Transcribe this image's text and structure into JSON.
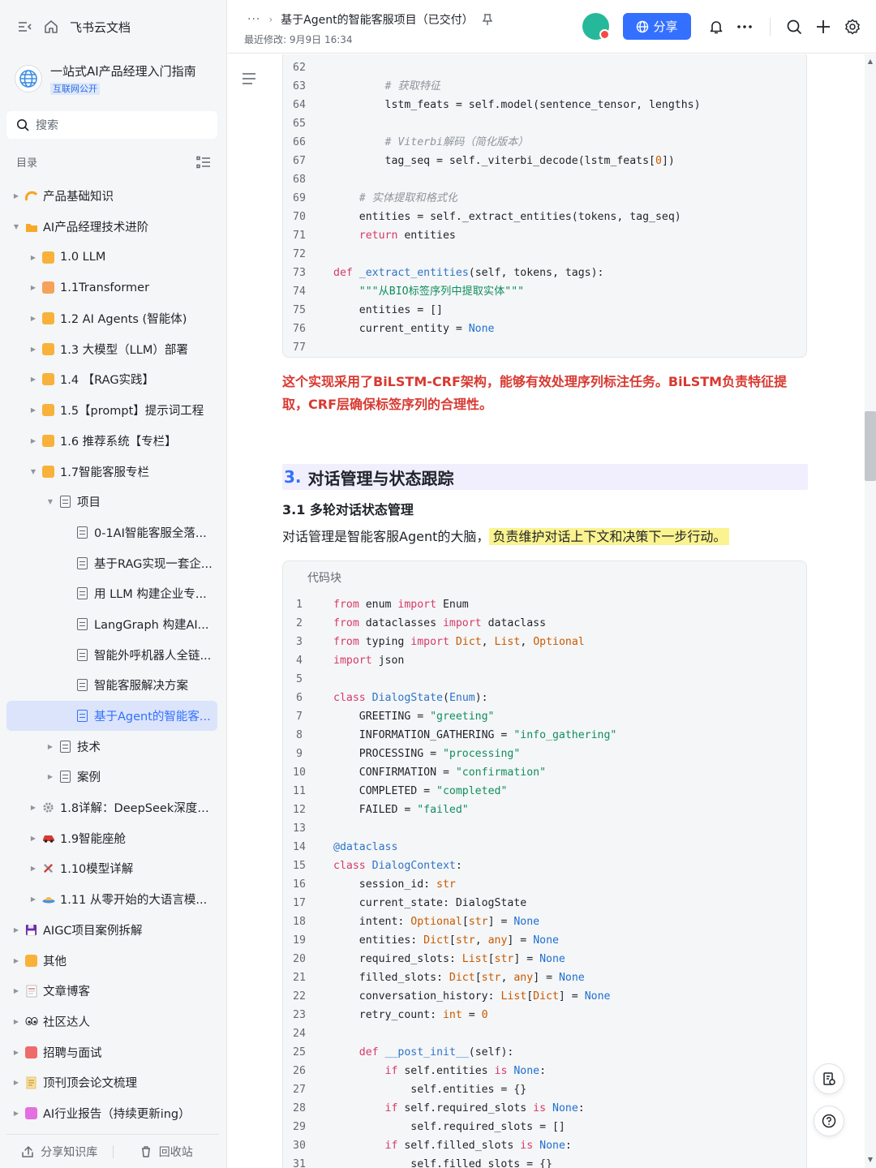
{
  "sidebar": {
    "brand": "飞书云文档",
    "kb_title": "一站式AI产品经理入门指南",
    "kb_tag": "互联网公开",
    "search_placeholder": "搜索",
    "toc_label": "目录",
    "tree": [
      {
        "label": "产品基础知识",
        "depth": 0,
        "arrow": "right",
        "icon": "sun-icon",
        "color": "#f5a623"
      },
      {
        "label": "AI产品经理技术进阶",
        "depth": 0,
        "arrow": "down",
        "icon": "folder-icon",
        "color": "#f7a928"
      },
      {
        "label": "1.0 LLM",
        "depth": 1,
        "arrow": "right",
        "icon": "square-icon",
        "color": "#f8b13a"
      },
      {
        "label": "1.1Transformer",
        "depth": 1,
        "arrow": "right",
        "icon": "square-icon",
        "color": "#f5a35a"
      },
      {
        "label": "1.2 AI Agents (智能体)",
        "depth": 1,
        "arrow": "right",
        "icon": "square-icon",
        "color": "#f8b13a"
      },
      {
        "label": "1.3 大模型（LLM）部署",
        "depth": 1,
        "arrow": "right",
        "icon": "square-icon",
        "color": "#f8b13a"
      },
      {
        "label": "1.4 【RAG实践】",
        "depth": 1,
        "arrow": "right",
        "icon": "square-icon",
        "color": "#f8b13a"
      },
      {
        "label": "1.5【prompt】提示词工程",
        "depth": 1,
        "arrow": "right",
        "icon": "square-icon",
        "color": "#f8b13a"
      },
      {
        "label": "1.6 推荐系统【专栏】",
        "depth": 1,
        "arrow": "right",
        "icon": "square-icon",
        "color": "#f8b13a"
      },
      {
        "label": "1.7智能客服专栏",
        "depth": 1,
        "arrow": "down",
        "icon": "square-icon",
        "color": "#f8b13a"
      },
      {
        "label": "项目",
        "depth": 2,
        "arrow": "down",
        "icon": "doc-icon",
        "color": ""
      },
      {
        "label": "0-1AI智能客服全落...",
        "depth": 3,
        "arrow": "",
        "icon": "doc-icon",
        "color": ""
      },
      {
        "label": "基于RAG实现一套企...",
        "depth": 3,
        "arrow": "",
        "icon": "doc-icon",
        "color": ""
      },
      {
        "label": "用 LLM 构建企业专...",
        "depth": 3,
        "arrow": "",
        "icon": "doc-icon",
        "color": ""
      },
      {
        "label": "LangGraph 构建AI...",
        "depth": 3,
        "arrow": "",
        "icon": "doc-icon",
        "color": ""
      },
      {
        "label": "智能外呼机器人全链...",
        "depth": 3,
        "arrow": "",
        "icon": "doc-icon",
        "color": ""
      },
      {
        "label": "智能客服解决方案",
        "depth": 3,
        "arrow": "",
        "icon": "doc-icon",
        "color": ""
      },
      {
        "label": "基于Agent的智能客...",
        "depth": 3,
        "arrow": "",
        "icon": "doc-icon",
        "color": "",
        "active": true
      },
      {
        "label": "技术",
        "depth": 2,
        "arrow": "right",
        "icon": "doc-icon",
        "color": ""
      },
      {
        "label": "案例",
        "depth": 2,
        "arrow": "right",
        "icon": "doc-icon",
        "color": ""
      },
      {
        "label": "1.8详解：DeepSeek深度推...",
        "depth": 1,
        "arrow": "right",
        "icon": "gear-icon",
        "color": "#8f959e"
      },
      {
        "label": "1.9智能座舱",
        "depth": 1,
        "arrow": "right",
        "icon": "car-icon",
        "color": "#d83931"
      },
      {
        "label": "1.10模型详解",
        "depth": 1,
        "arrow": "right",
        "icon": "tools-icon",
        "color": "#d83931"
      },
      {
        "label": "1.11 从零开始的大语言模...",
        "depth": 1,
        "arrow": "right",
        "icon": "ufo-icon",
        "color": "#4a90e2"
      },
      {
        "label": "AIGC项目案例拆解",
        "depth": 0,
        "arrow": "right",
        "icon": "floppy-icon",
        "color": "#6b2fa8"
      },
      {
        "label": "其他",
        "depth": 0,
        "arrow": "right",
        "icon": "square-icon",
        "color": "#f8b13a"
      },
      {
        "label": "文章博客",
        "depth": 0,
        "arrow": "right",
        "icon": "page-icon",
        "color": "#e0e0ef"
      },
      {
        "label": "社区达人",
        "depth": 0,
        "arrow": "right",
        "icon": "eyes-icon",
        "color": "#1f2329"
      },
      {
        "label": "招聘与面试",
        "depth": 0,
        "arrow": "right",
        "icon": "square-icon",
        "color": "#ef6b6b"
      },
      {
        "label": "顶刊顶会论文梳理",
        "depth": 0,
        "arrow": "right",
        "icon": "scroll-icon",
        "color": "#e8c26a"
      },
      {
        "label": "AI行业报告（持续更新ing）",
        "depth": 0,
        "arrow": "right",
        "icon": "square-icon",
        "color": "#e36fe0"
      }
    ],
    "footer": {
      "share": "分享知识库",
      "trash": "回收站"
    }
  },
  "header": {
    "breadcrumb_dots": "···",
    "doc_title": "基于Agent的智能客服项目（已交付）",
    "modified": "最近修改: 9月9日 16:34",
    "share_label": "分享"
  },
  "content": {
    "note": "这个实现采用了BiLSTM-CRF架构，能够有效处理序列标注任务。BiLSTM负责特征提取，CRF层确保标签序列的合理性。",
    "h2_num": "3.",
    "h2_text": "对话管理与状态跟踪",
    "h3": "3.1 多轮对话状态管理",
    "para_plain": "对话管理是智能客服Agent的大脑，",
    "para_highlight": "负责维护对话上下文和决策下一步行动。",
    "code_label": "代码块"
  },
  "code_block_1": [
    {
      "n": "62",
      "code": ""
    },
    {
      "n": "63",
      "code": "        <c># 获取特征</c>"
    },
    {
      "n": "64",
      "code": "        lstm_feats = self.model(sentence_tensor, lengths)"
    },
    {
      "n": "65",
      "code": ""
    },
    {
      "n": "66",
      "code": "        <c># Viterbi解码（简化版本）</c>"
    },
    {
      "n": "67",
      "code": "        tag_seq = self._viterbi_decode(lstm_feats[<n>0</n>])"
    },
    {
      "n": "68",
      "code": ""
    },
    {
      "n": "69",
      "code": "    <c># 实体提取和格式化</c>"
    },
    {
      "n": "70",
      "code": "    entities = self._extract_entities(tokens, tag_seq)"
    },
    {
      "n": "71",
      "code": "    <k>return</k> entities"
    },
    {
      "n": "72",
      "code": ""
    },
    {
      "n": "73",
      "code": "<k>def</k> <f>_extract_entities</f>(self, tokens, tags):"
    },
    {
      "n": "74",
      "code": "    <s>\"\"\"从BIO标签序列中提取实体\"\"\"</s>"
    },
    {
      "n": "75",
      "code": "    entities = []"
    },
    {
      "n": "76",
      "code": "    current_entity = <b>None</b>"
    },
    {
      "n": "77",
      "code": ""
    }
  ],
  "code_block_2": [
    {
      "n": "1",
      "code": "<k>from</k> enum <k>import</k> Enum"
    },
    {
      "n": "2",
      "code": "<k>from</k> dataclasses <k>import</k> dataclass"
    },
    {
      "n": "3",
      "code": "<k>from</k> typing <k>import</k> <t>Dict</t>, <t>List</t>, <t>Optional</t>"
    },
    {
      "n": "4",
      "code": "<k>import</k> json"
    },
    {
      "n": "5",
      "code": ""
    },
    {
      "n": "6",
      "code": "<k>class</k> <f>DialogState</f>(<f>Enum</f>):"
    },
    {
      "n": "7",
      "code": "    GREETING = <s>\"greeting\"</s>"
    },
    {
      "n": "8",
      "code": "    INFORMATION_GATHERING = <s>\"info_gathering\"</s>"
    },
    {
      "n": "9",
      "code": "    PROCESSING = <s>\"processing\"</s>"
    },
    {
      "n": "10",
      "code": "    CONFIRMATION = <s>\"confirmation\"</s>"
    },
    {
      "n": "11",
      "code": "    COMPLETED = <s>\"completed\"</s>"
    },
    {
      "n": "12",
      "code": "    FAILED = <s>\"failed\"</s>"
    },
    {
      "n": "13",
      "code": ""
    },
    {
      "n": "14",
      "code": "<d>@dataclass</d>"
    },
    {
      "n": "15",
      "code": "<k>class</k> <f>DialogContext</f>:"
    },
    {
      "n": "16",
      "code": "    session_id: <t>str</t>"
    },
    {
      "n": "17",
      "code": "    current_state: DialogState"
    },
    {
      "n": "18",
      "code": "    intent: <t>Optional</t>[<t>str</t>] = <b>None</b>"
    },
    {
      "n": "19",
      "code": "    entities: <t>Dict</t>[<t>str</t>, <t>any</t>] = <b>None</b>"
    },
    {
      "n": "20",
      "code": "    required_slots: <t>List</t>[<t>str</t>] = <b>None</b>"
    },
    {
      "n": "21",
      "code": "    filled_slots: <t>Dict</t>[<t>str</t>, <t>any</t>] = <b>None</b>"
    },
    {
      "n": "22",
      "code": "    conversation_history: <t>List</t>[<t>Dict</t>] = <b>None</b>"
    },
    {
      "n": "23",
      "code": "    retry_count: <t>int</t> = <n>0</n>"
    },
    {
      "n": "24",
      "code": ""
    },
    {
      "n": "25",
      "code": "    <k>def</k> <f>__post_init__</f>(self):"
    },
    {
      "n": "26",
      "code": "        <k>if</k> self.entities <k>is</k> <b>None</b>:"
    },
    {
      "n": "27",
      "code": "            self.entities = {}"
    },
    {
      "n": "28",
      "code": "        <k>if</k> self.required_slots <k>is</k> <b>None</b>:"
    },
    {
      "n": "29",
      "code": "            self.required_slots = []"
    },
    {
      "n": "30",
      "code": "        <k>if</k> self.filled_slots <k>is</k> <b>None</b>:"
    },
    {
      "n": "31",
      "code": "            self.filled_slots = {}"
    }
  ],
  "colors": {
    "accent": "#3370ff",
    "note_red": "#d83931",
    "highlight": "#fbf38f",
    "h2_bg": "#f1effd"
  }
}
